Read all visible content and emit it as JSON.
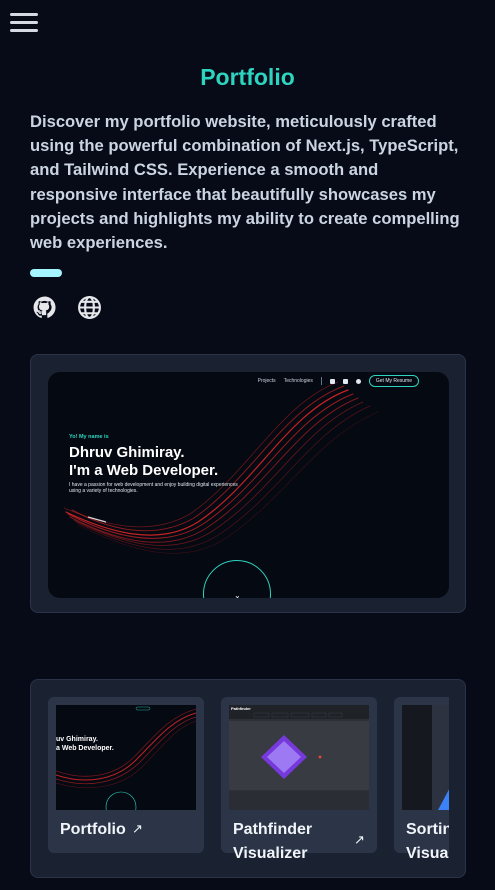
{
  "header": {
    "menu_icon": "hamburger-menu-icon"
  },
  "project": {
    "title": "Portfolio",
    "description": "Discover my portfolio website, meticulously crafted using the powerful combination of Next.js, TypeScript, and Tailwind CSS. Experience a smooth and responsive interface that beautifully showcases my projects and highlights my ability to create compelling web experiences.",
    "links": [
      {
        "icon": "github-icon"
      },
      {
        "icon": "globe-icon"
      }
    ]
  },
  "preview": {
    "nav": [
      "Projects",
      "Technologies"
    ],
    "nav_button": "Get My Resume",
    "greeting": "Yo! My name is",
    "name_line1": "Dhruv Ghimiray.",
    "name_line2": "I'm a Web Developer.",
    "tagline": "I have a passion for web development and enjoy building digital experiences using a variety of technologies.",
    "scroll_icon": "chevron-down-icon",
    "accent": "#2dd4bf",
    "swoosh_color": "#dc2626"
  },
  "gallery": {
    "items": [
      {
        "label": "Portfolio",
        "thumb_text_1": "uv Ghimiray.",
        "thumb_text_2": "a Web Developer."
      },
      {
        "label": "Pathfinder Visualizer",
        "thumb_title": "Pathfinder"
      },
      {
        "label": "Sorting Visualizer"
      }
    ]
  }
}
